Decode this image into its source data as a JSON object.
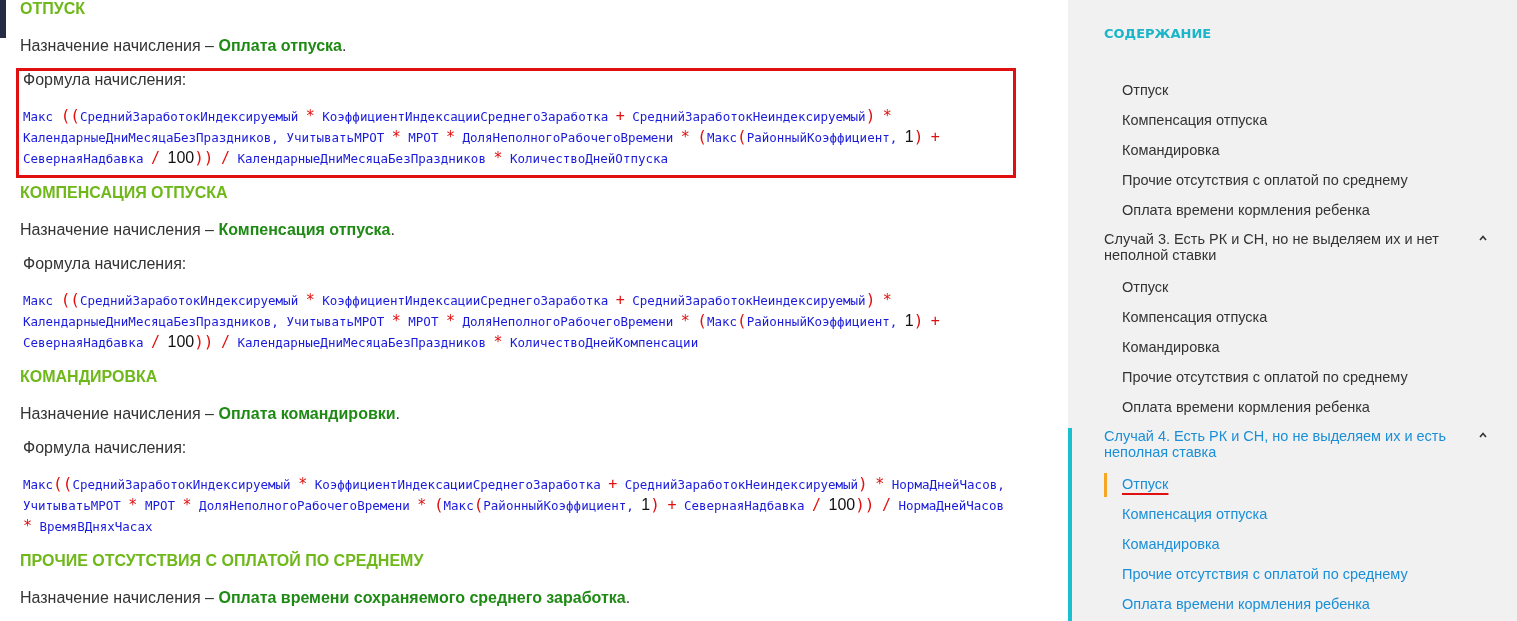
{
  "sections": [
    {
      "title": "ОТПУСК",
      "assignment_label": "Назначение начисления –",
      "assignment_value": "Оплата отпуска",
      "assignment_end": ".",
      "formula_label": "Формула начисления:",
      "formula": "Макс ((СреднийЗаработокИндексируемый * КоэффициентИндексацииСреднегоЗаработка + СреднийЗаработокНеиндексируемый) * КалендарныеДниМесяцаБезПраздников, УчитыватьМРОТ * МРОТ * ДоляНеполногоРабочегоВремени * (Макс(РайонныйКоэффициент, 1) + СевернаяНадбавка / 100)) / КалендарныеДниМесяцаБезПраздников * КоличествоДнейОтпуска",
      "highlighted": true
    },
    {
      "title": "КОМПЕНСАЦИЯ ОТПУСКА",
      "assignment_label": "Назначение начисления –",
      "assignment_value": "Компенсация отпуска",
      "assignment_end": ".",
      "formula_label": "Формула начисления:",
      "formula": "Макс ((СреднийЗаработокИндексируемый * КоэффициентИндексацииСреднегоЗаработка + СреднийЗаработокНеиндексируемый) * КалендарныеДниМесяцаБезПраздников, УчитыватьМРОТ * МРОТ * ДоляНеполногоРабочегоВремени * (Макс(РайонныйКоэффициент, 1) + СевернаяНадбавка / 100)) / КалендарныеДниМесяцаБезПраздников * КоличествоДнейКомпенсации",
      "highlighted": false
    },
    {
      "title": "КОМАНДИРОВКА",
      "assignment_label": "Назначение начисления –",
      "assignment_value": "Оплата командировки",
      "assignment_end": ".",
      "formula_label": "Формула начисления:",
      "formula": "Макс((СреднийЗаработокИндексируемый * КоэффициентИндексацииСреднегоЗаработка + СреднийЗаработокНеиндексируемый) * НормаДнейЧасов, УчитыватьМРОТ * МРОТ * ДоляНеполногоРабочегоВремени * (Макс(РайонныйКоэффициент, 1) + СевернаяНадбавка / 100)) / НормаДнейЧасов * ВремяВДняхЧасах",
      "highlighted": false
    },
    {
      "title": "ПРОЧИЕ ОТСУТСТВИЯ С ОПЛАТОЙ ПО СРЕДНЕМУ",
      "assignment_label": "Назначение начисления –",
      "assignment_value": "Оплата времени сохраняемого среднего заработка",
      "assignment_end": ".",
      "highlighted": false
    }
  ],
  "sidebar": {
    "heading": "СОДЕРЖАНИЕ",
    "groups": [
      {
        "expanded": true,
        "active": false,
        "items": [
          {
            "label": "Отпуск",
            "selected": false,
            "underlined": false
          },
          {
            "label": "Компенсация отпуска",
            "selected": false,
            "underlined": false
          },
          {
            "label": "Командировка",
            "selected": false,
            "underlined": false
          },
          {
            "label": "Прочие отсутствия с оплатой по среднему",
            "selected": false,
            "underlined": false
          },
          {
            "label": "Оплата времени кормления ребенка",
            "selected": false,
            "underlined": false
          }
        ]
      },
      {
        "title": "Случай 3. Есть РК и СН, но не выделяем их и нет неполной ставки",
        "expanded": true,
        "active": false,
        "items": [
          {
            "label": "Отпуск",
            "selected": false,
            "underlined": false
          },
          {
            "label": "Компенсация отпуска",
            "selected": false,
            "underlined": false
          },
          {
            "label": "Командировка",
            "selected": false,
            "underlined": false
          },
          {
            "label": "Прочие отсутствия с оплатой по среднему",
            "selected": false,
            "underlined": false
          },
          {
            "label": "Оплата времени кормления ребенка",
            "selected": false,
            "underlined": false
          }
        ]
      },
      {
        "title": "Случай 4. Есть РК и СН, но не выделяем их и есть неполная ставка",
        "expanded": true,
        "active": true,
        "items": [
          {
            "label": "Отпуск",
            "selected": true,
            "underlined": true
          },
          {
            "label": "Компенсация отпуска",
            "selected": false,
            "underlined": false
          },
          {
            "label": "Командировка",
            "selected": false,
            "underlined": false
          },
          {
            "label": "Прочие отсутствия с оплатой по среднему",
            "selected": false,
            "underlined": false
          },
          {
            "label": "Оплата времени кормления ребенка",
            "selected": false,
            "underlined": false
          }
        ]
      }
    ]
  }
}
